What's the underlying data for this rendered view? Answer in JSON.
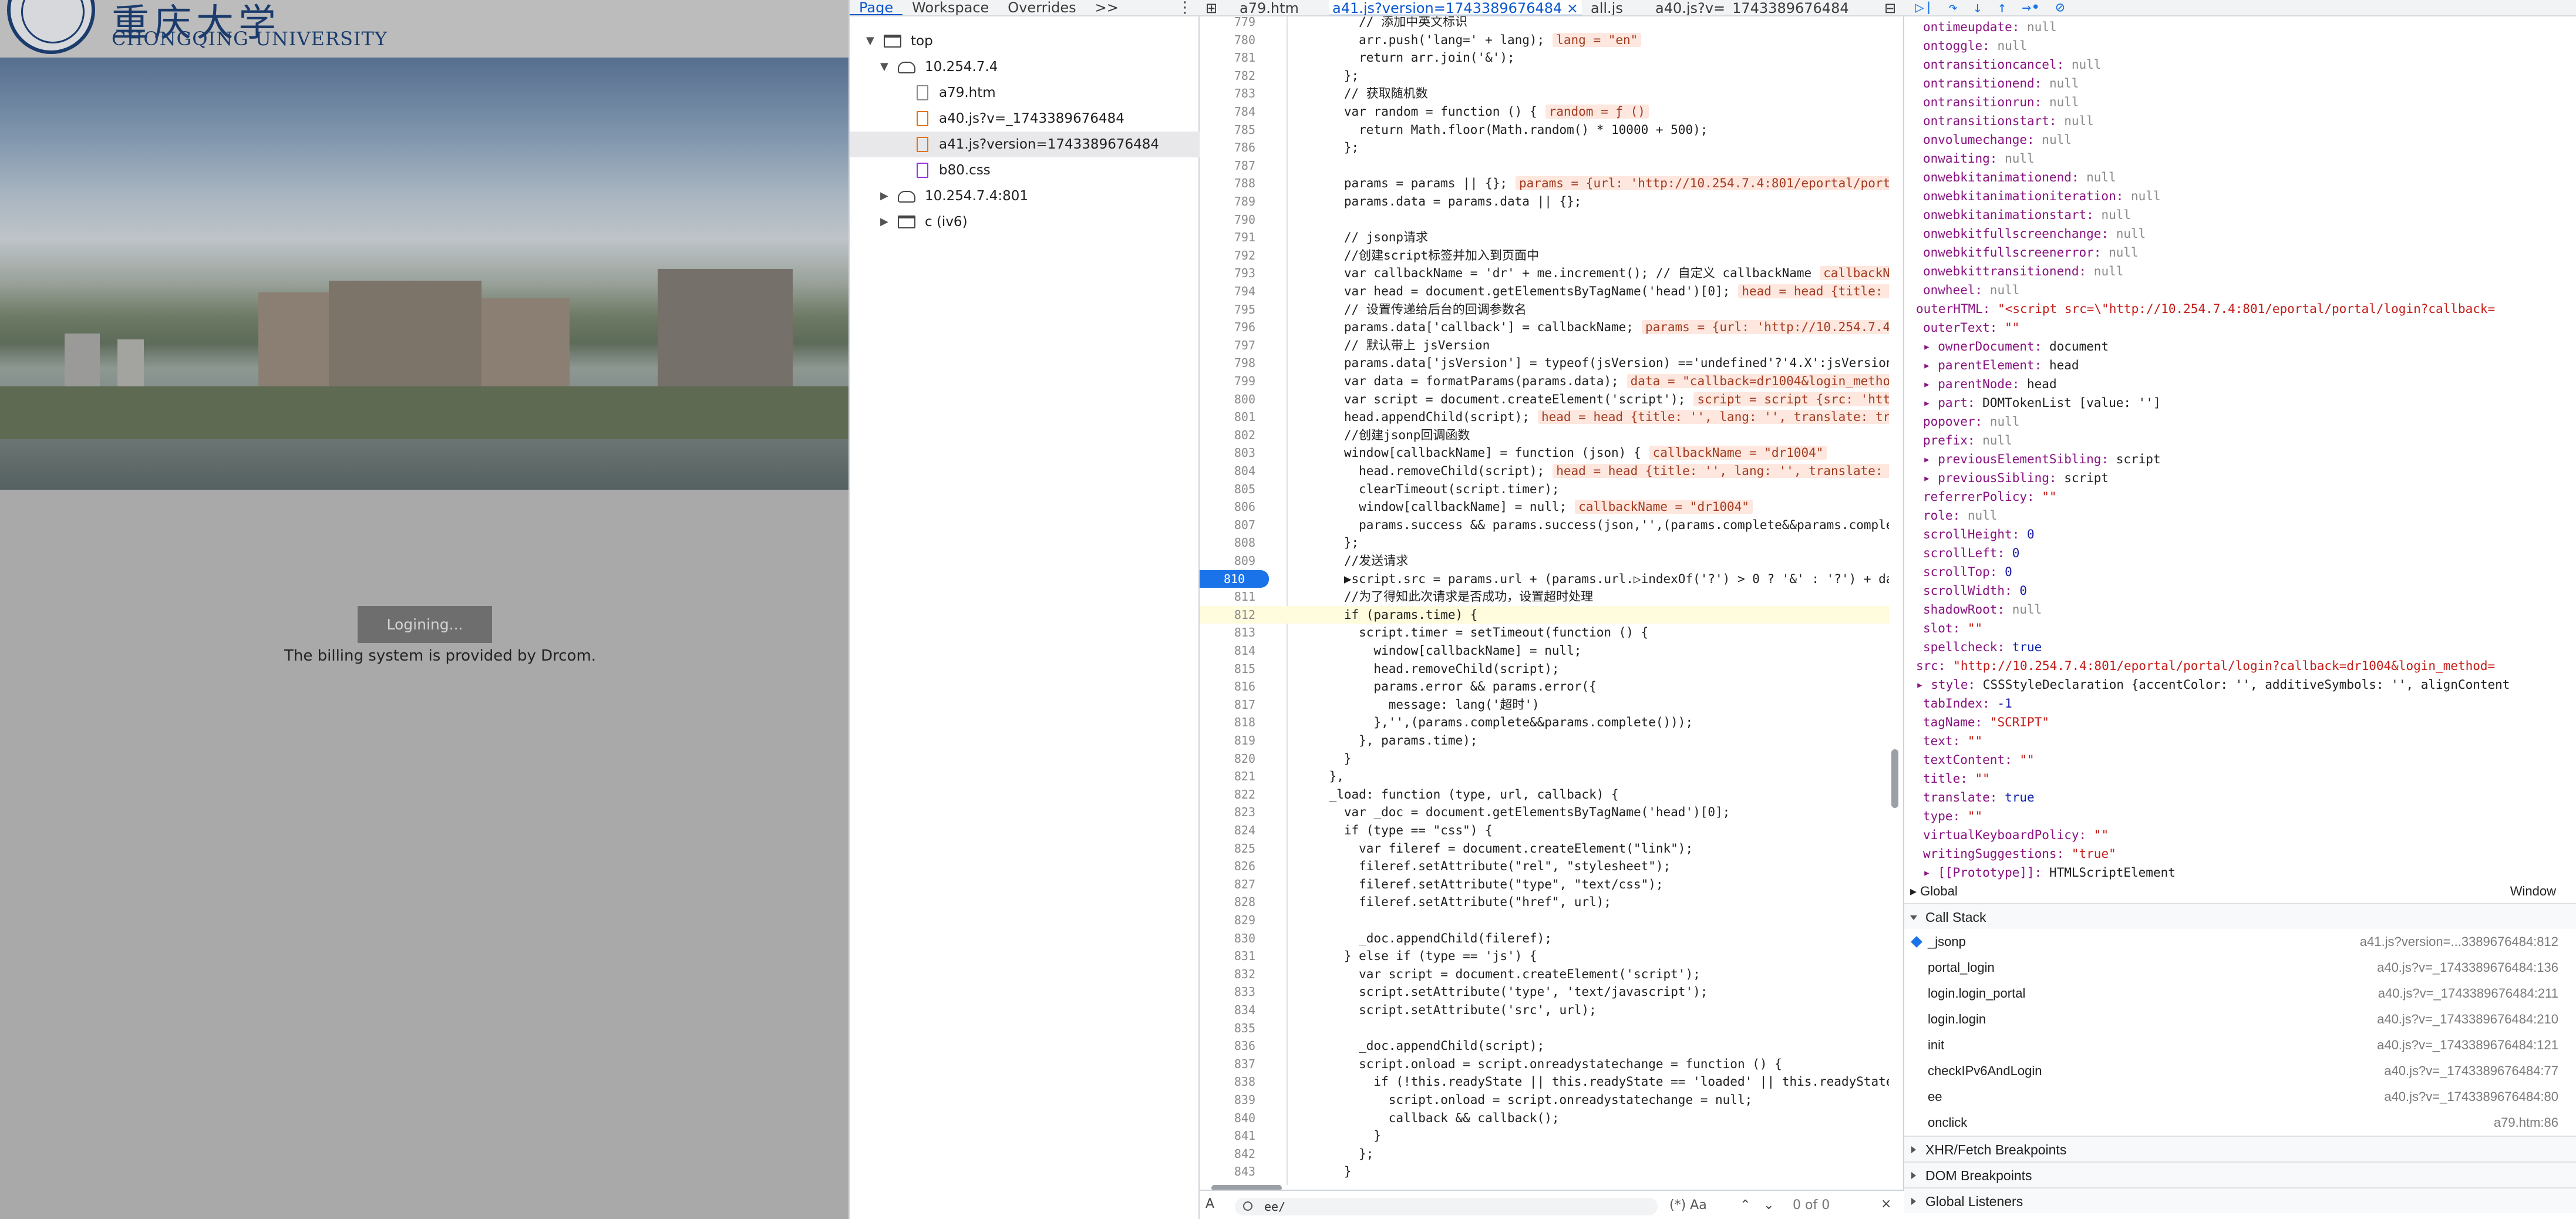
{
  "page": {
    "logo_cn": "重庆大学",
    "logo_en": "CHONGQING UNIVERSITY",
    "loading": "Logining...",
    "billing": "The billing system is provided by Drcom."
  },
  "navigator": {
    "tabs": [
      "Page",
      "Workspace",
      "Overrides",
      ">>"
    ],
    "more": "⋮",
    "tree": [
      {
        "label": "top",
        "icon": "frame-icon"
      },
      {
        "label": "10.254.7.4",
        "icon": "cloud-icon"
      },
      {
        "label": "a79.htm",
        "icon": "file-icon"
      },
      {
        "label": "a40.js?v=_1743389676484",
        "icon": "js-file-icon"
      },
      {
        "label": "a41.js?version=1743389676484",
        "icon": "js-file-icon"
      },
      {
        "label": "b80.css",
        "icon": "css-file-icon"
      },
      {
        "label": "10.254.7.4:801",
        "icon": "cloud-icon"
      },
      {
        "label": "c (iv6)",
        "icon": "frame-icon"
      }
    ]
  },
  "editor": {
    "tabs": [
      "a79.htm",
      "a41.js?version=1743389676484 ×",
      "all.js",
      "a40.js?v=_1743389676484"
    ],
    "lines": [
      {
        "n": "779",
        "t": "        // 添加中英文标识"
      },
      {
        "n": "780",
        "t": "        arr.push('lang=' + lang);",
        "h": "lang = \"en\""
      },
      {
        "n": "781",
        "t": "        return arr.join('&');"
      },
      {
        "n": "782",
        "t": "      };"
      },
      {
        "n": "783",
        "t": "      // 获取随机数"
      },
      {
        "n": "784",
        "t": "      var random = function () {",
        "h": "random = ƒ ()"
      },
      {
        "n": "785",
        "t": "        return Math.floor(Math.random() * 10000 + 500);"
      },
      {
        "n": "786",
        "t": "      };"
      },
      {
        "n": "787",
        "t": ""
      },
      {
        "n": "788",
        "t": "      params = params || {};",
        "h": "params = {url: 'http://10.254.7.4:801/eportal/portal"
      },
      {
        "n": "789",
        "t": "      params.data = params.data || {};"
      },
      {
        "n": "790",
        "t": ""
      },
      {
        "n": "791",
        "t": "      // jsonp请求"
      },
      {
        "n": "792",
        "t": "      //创建script标签并加入到页面中"
      },
      {
        "n": "793",
        "t": "      var callbackName = 'dr' + me.increment(); // 自定义 callbackName",
        "h": "callbackNam"
      },
      {
        "n": "794",
        "t": "      var head = document.getElementsByTagName('head')[0];",
        "h": "head = head {title: ''"
      },
      {
        "n": "795",
        "t": "      // 设置传递给后台的回调参数名"
      },
      {
        "n": "796",
        "t": "      params.data['callback'] = callbackName;",
        "h": "params = {url: 'http://10.254.7.4:8"
      },
      {
        "n": "797",
        "t": "      // 默认带上 jsVersion"
      },
      {
        "n": "798",
        "t": "      params.data['jsVersion'] = typeof(jsVersion) =='undefined'?'4.X':jsVersion;"
      },
      {
        "n": "799",
        "t": "      var data = formatParams(params.data);",
        "h": "data = \"callback=dr1004&login_method="
      },
      {
        "n": "800",
        "t": "      var script = document.createElement('script');",
        "h": "script = script {src: 'http:"
      },
      {
        "n": "801",
        "t": "      head.appendChild(script);",
        "h": "head = head {title: '', lang: '', translate: true"
      },
      {
        "n": "802",
        "t": "      //创建jsonp回调函数"
      },
      {
        "n": "803",
        "t": "      window[callbackName] = function (json) {",
        "h": "callbackName = \"dr1004\""
      },
      {
        "n": "804",
        "t": "        head.removeChild(script);",
        "h": "head = head {title: '', lang: '', translate: tr"
      },
      {
        "n": "805",
        "t": "        clearTimeout(script.timer);"
      },
      {
        "n": "806",
        "t": "        window[callbackName] = null;",
        "h": "callbackName = \"dr1004\""
      },
      {
        "n": "807",
        "t": "        params.success && params.success(json,'',(params.complete&&params.complete"
      },
      {
        "n": "808",
        "t": "      };"
      },
      {
        "n": "809",
        "t": "      //发送请求"
      },
      {
        "n": "810",
        "t": "      ▶script.src = params.url + (params.url.▷indexOf('?') > 0 ? '&' : '?') + dat",
        "bp": true
      },
      {
        "n": "811",
        "t": "      //为了得知此次请求是否成功，设置超时处理"
      },
      {
        "n": "812",
        "t": "      if (params.time) {",
        "paused": true
      },
      {
        "n": "813",
        "t": "        script.timer = setTimeout(function () {"
      },
      {
        "n": "814",
        "t": "          window[callbackName] = null;"
      },
      {
        "n": "815",
        "t": "          head.removeChild(script);"
      },
      {
        "n": "816",
        "t": "          params.error && params.error({"
      },
      {
        "n": "817",
        "t": "            message: lang('超时')"
      },
      {
        "n": "818",
        "t": "          },'',(params.complete&&params.complete()));"
      },
      {
        "n": "819",
        "t": "        }, params.time);"
      },
      {
        "n": "820",
        "t": "      }"
      },
      {
        "n": "821",
        "t": "    },"
      },
      {
        "n": "822",
        "t": "    _load: function (type, url, callback) {"
      },
      {
        "n": "823",
        "t": "      var _doc = document.getElementsByTagName('head')[0];"
      },
      {
        "n": "824",
        "t": "      if (type == \"css\") {"
      },
      {
        "n": "825",
        "t": "        var fileref = document.createElement(\"link\");"
      },
      {
        "n": "826",
        "t": "        fileref.setAttribute(\"rel\", \"stylesheet\");"
      },
      {
        "n": "827",
        "t": "        fileref.setAttribute(\"type\", \"text/css\");"
      },
      {
        "n": "828",
        "t": "        fileref.setAttribute(\"href\", url);"
      },
      {
        "n": "829",
        "t": ""
      },
      {
        "n": "830",
        "t": "        _doc.appendChild(fileref);"
      },
      {
        "n": "831",
        "t": "      } else if (type == 'js') {"
      },
      {
        "n": "832",
        "t": "        var script = document.createElement('script');"
      },
      {
        "n": "833",
        "t": "        script.setAttribute('type', 'text/javascript');"
      },
      {
        "n": "834",
        "t": "        script.setAttribute('src', url);"
      },
      {
        "n": "835",
        "t": ""
      },
      {
        "n": "836",
        "t": "        _doc.appendChild(script);"
      },
      {
        "n": "837",
        "t": "        script.onload = script.onreadystatechange = function () {"
      },
      {
        "n": "838",
        "t": "          if (!this.readyState || this.readyState == 'loaded' || this.readyState ="
      },
      {
        "n": "839",
        "t": "            script.onload = script.onreadystatechange = null;"
      },
      {
        "n": "840",
        "t": "            callback && callback();"
      },
      {
        "n": "841",
        "t": "          }"
      },
      {
        "n": "842",
        "t": "        };"
      },
      {
        "n": "843",
        "t": "      }"
      }
    ],
    "search_value": "ee/",
    "search_meta": "(*) Aa",
    "search_count": "0 of 0",
    "search_close": "×"
  },
  "sidebar": {
    "toolbar_icons": [
      "resume-icon",
      "step-over-icon",
      "step-into-icon",
      "step-out-icon",
      "step-icon",
      "deactivate-breakpoints-icon"
    ],
    "scope": [
      {
        "k": "ontimeupdate",
        "v": "null",
        "c": "null"
      },
      {
        "k": "ontoggle",
        "v": "null",
        "c": "null"
      },
      {
        "k": "ontransitioncancel",
        "v": "null",
        "c": "null"
      },
      {
        "k": "ontransitionend",
        "v": "null",
        "c": "null"
      },
      {
        "k": "ontransitionrun",
        "v": "null",
        "c": "null"
      },
      {
        "k": "ontransitionstart",
        "v": "null",
        "c": "null"
      },
      {
        "k": "onvolumechange",
        "v": "null",
        "c": "null"
      },
      {
        "k": "onwaiting",
        "v": "null",
        "c": "null"
      },
      {
        "k": "onwebkitanimationend",
        "v": "null",
        "c": "null"
      },
      {
        "k": "onwebkitanimationiteration",
        "v": "null",
        "c": "null"
      },
      {
        "k": "onwebkitanimationstart",
        "v": "null",
        "c": "null"
      },
      {
        "k": "onwebkitfullscreenchange",
        "v": "null",
        "c": "null"
      },
      {
        "k": "onwebkitfullscreenerror",
        "v": "null",
        "c": "null"
      },
      {
        "k": "onwebkittransitionend",
        "v": "null",
        "c": "null"
      },
      {
        "k": "onwheel",
        "v": "null",
        "c": "null"
      },
      {
        "k": "outerHTML",
        "v": "\"<script src=\\\"http://10.254.7.4:801/eportal/portal/login?callback=",
        "c": "str",
        "indent": 0
      },
      {
        "k": "outerText",
        "v": "\"\"",
        "c": "str"
      },
      {
        "k": "▸ ownerDocument",
        "v": "document",
        "c": "obj"
      },
      {
        "k": "▸ parentElement",
        "v": "head",
        "c": "obj"
      },
      {
        "k": "▸ parentNode",
        "v": "head",
        "c": "obj"
      },
      {
        "k": "▸ part",
        "v": "DOMTokenList [value: '']",
        "c": "obj"
      },
      {
        "k": "popover",
        "v": "null",
        "c": "null"
      },
      {
        "k": "prefix",
        "v": "null",
        "c": "null"
      },
      {
        "k": "▸ previousElementSibling",
        "v": "script",
        "c": "obj"
      },
      {
        "k": "▸ previousSibling",
        "v": "script",
        "c": "obj"
      },
      {
        "k": "referrerPolicy",
        "v": "\"\"",
        "c": "str"
      },
      {
        "k": "role",
        "v": "null",
        "c": "null"
      },
      {
        "k": "scrollHeight",
        "v": "0",
        "c": "num"
      },
      {
        "k": "scrollLeft",
        "v": "0",
        "c": "num"
      },
      {
        "k": "scrollTop",
        "v": "0",
        "c": "num"
      },
      {
        "k": "scrollWidth",
        "v": "0",
        "c": "num"
      },
      {
        "k": "shadowRoot",
        "v": "null",
        "c": "null"
      },
      {
        "k": "slot",
        "v": "\"\"",
        "c": "str"
      },
      {
        "k": "spellcheck",
        "v": "true",
        "c": "kw"
      },
      {
        "k": "src",
        "v": "\"http://10.254.7.4:801/eportal/portal/login?callback=dr1004&login_method=",
        "c": "str",
        "indent": 0
      },
      {
        "k": "▸ style",
        "v": "CSSStyleDeclaration {accentColor: '', additiveSymbols: '', alignContent",
        "c": "obj",
        "indent": 0
      },
      {
        "k": "tabIndex",
        "v": "-1",
        "c": "num"
      },
      {
        "k": "tagName",
        "v": "\"SCRIPT\"",
        "c": "str"
      },
      {
        "k": "text",
        "v": "\"\"",
        "c": "str"
      },
      {
        "k": "textContent",
        "v": "\"\"",
        "c": "str"
      },
      {
        "k": "title",
        "v": "\"\"",
        "c": "str"
      },
      {
        "k": "translate",
        "v": "true",
        "c": "kw"
      },
      {
        "k": "type",
        "v": "\"\"",
        "c": "str"
      },
      {
        "k": "virtualKeyboardPolicy",
        "v": "\"\"",
        "c": "str"
      },
      {
        "k": "writingSuggestions",
        "v": "\"true\"",
        "c": "str"
      },
      {
        "k": "▸ [[Prototype]]",
        "v": "HTMLScriptElement",
        "c": "obj"
      }
    ],
    "global_label": "Global",
    "global_value": "Window",
    "callstack_title": "Call Stack",
    "callstack": [
      {
        "fn": "_jsonp",
        "loc": "a41.js?version=...3389676484:812"
      },
      {
        "fn": "portal_login",
        "loc": "a40.js?v=_1743389676484:136"
      },
      {
        "fn": "login.login_portal",
        "loc": "a40.js?v=_1743389676484:211"
      },
      {
        "fn": "login.login",
        "loc": "a40.js?v=_1743389676484:210"
      },
      {
        "fn": "init",
        "loc": "a40.js?v=_1743389676484:121"
      },
      {
        "fn": "checkIPv6AndLogin",
        "loc": "a40.js?v=_1743389676484:77"
      },
      {
        "fn": "ee",
        "loc": "a40.js?v=_1743389676484:80"
      },
      {
        "fn": "onclick",
        "loc": "a79.htm:86"
      }
    ],
    "sections_after": [
      "XHR/Fetch Breakpoints",
      "DOM Breakpoints",
      "Global Listeners"
    ]
  }
}
